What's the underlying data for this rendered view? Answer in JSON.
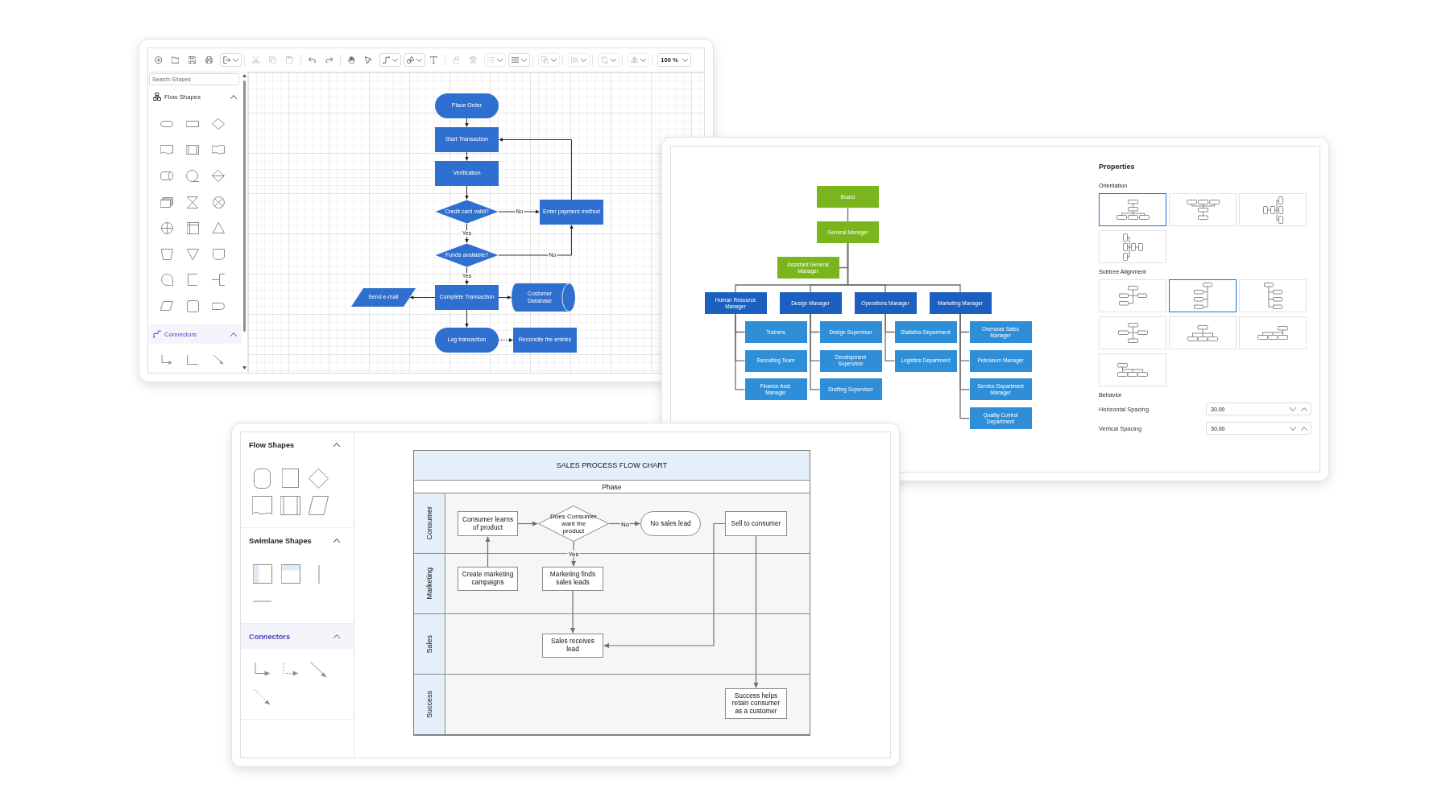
{
  "flowchart_editor": {
    "toolbar": {
      "groups": [
        {
          "items": [
            {
              "kind": "button",
              "disabled": false
            },
            {
              "kind": "button",
              "disabled": false
            },
            {
              "kind": "button",
              "disabled": false
            },
            {
              "kind": "button",
              "disabled": false
            },
            {
              "kind": "dropdown",
              "disabled": false
            }
          ]
        },
        {
          "items": [
            {
              "kind": "button",
              "disabled": true
            },
            {
              "kind": "button",
              "disabled": true
            },
            {
              "kind": "button",
              "disabled": true
            }
          ]
        },
        {
          "items": [
            {
              "kind": "button",
              "disabled": false
            },
            {
              "kind": "button",
              "disabled": false
            }
          ]
        },
        {
          "items": [
            {
              "kind": "button",
              "disabled": false
            },
            {
              "kind": "button",
              "disabled": false
            },
            {
              "kind": "dropdown",
              "disabled": false
            },
            {
              "kind": "dropdown",
              "disabled": false
            },
            {
              "kind": "button",
              "disabled": false
            }
          ]
        },
        {
          "items": [
            {
              "kind": "button",
              "disabled": true
            },
            {
              "kind": "button",
              "disabled": true
            },
            {
              "kind": "dropdown",
              "disabled": true
            },
            {
              "kind": "dropdown",
              "disabled": false
            }
          ]
        },
        {
          "items": [
            {
              "kind": "dropdown",
              "disabled": true
            }
          ]
        },
        {
          "items": [
            {
              "kind": "dropdown",
              "disabled": true
            }
          ]
        },
        {
          "items": [
            {
              "kind": "dropdown",
              "disabled": true
            }
          ]
        },
        {
          "items": [
            {
              "kind": "dropdown",
              "disabled": true
            }
          ]
        }
      ],
      "zoom": "100 %"
    },
    "sidebar": {
      "search": {
        "placeholder": "Search Shapes"
      },
      "sections": [
        {
          "kind": "flow",
          "title": "Flow Shapes",
          "expanded": true,
          "selected": false
        },
        {
          "kind": "connector",
          "title": "Connectors",
          "expanded": true,
          "selected": true
        }
      ]
    },
    "diagram": {
      "nodes": [
        {
          "kind": "terminator",
          "label": "Place Order"
        },
        {
          "kind": "process",
          "label": "Start Transaction"
        },
        {
          "kind": "process",
          "label": "Verification"
        },
        {
          "kind": "decision",
          "label": "Credit card valid?"
        },
        {
          "kind": "process",
          "label": "Enter payment method"
        },
        {
          "kind": "decision",
          "label": "Funds available?"
        },
        {
          "kind": "data",
          "label": "Send e-mail"
        },
        {
          "kind": "process",
          "label": "Complete Transaction"
        },
        {
          "kind": "database",
          "label": "Customer Database"
        },
        {
          "kind": "terminator",
          "label": "Log transaction"
        },
        {
          "kind": "process",
          "label": "Reconcile the entries"
        }
      ],
      "connector_labels": [
        "No",
        "Yes",
        "No",
        "Yes"
      ]
    }
  },
  "org_chart_editor": {
    "org_chart": {
      "root": {
        "label": "Board",
        "color": "#7ab51d",
        "children": [
          {
            "label": "General Manager",
            "color": "#7ab51d",
            "children": [
              {
                "label": "Assistant General Manager",
                "color": "#7ab51d"
              },
              {
                "label": "Human Resource Manager",
                "color": "#1b5fbf",
                "children": [
                  {
                    "label": "Trainers",
                    "color": "#2e8ed8"
                  },
                  {
                    "label": "Recruiting Team",
                    "color": "#2e8ed8"
                  },
                  {
                    "label": "Finance Asst. Manager",
                    "color": "#2e8ed8"
                  }
                ]
              },
              {
                "label": "Design Manager",
                "color": "#1b5fbf",
                "children": [
                  {
                    "label": "Design Supervisor",
                    "color": "#2e8ed8"
                  },
                  {
                    "label": "Development Supervisor",
                    "color": "#2e8ed8"
                  },
                  {
                    "label": "Drafting Supervisor",
                    "color": "#2e8ed8"
                  }
                ]
              },
              {
                "label": "Operations Manager",
                "color": "#1b5fbf",
                "children": [
                  {
                    "label": "Statistics Department",
                    "color": "#2e8ed8"
                  },
                  {
                    "label": "Logistics Department",
                    "color": "#2e8ed8"
                  }
                ]
              },
              {
                "label": "Marketing Manager",
                "color": "#1b5fbf",
                "children": [
                  {
                    "label": "Overseas Sales Manager",
                    "color": "#2e8ed8"
                  },
                  {
                    "label": "Petroleum Manager",
                    "color": "#2e8ed8"
                  },
                  {
                    "label": "Service Department Manager",
                    "color": "#2e8ed8"
                  },
                  {
                    "label": "Quality Control Department",
                    "color": "#2e8ed8"
                  }
                ]
              }
            ]
          }
        ]
      }
    },
    "properties": {
      "title": "Properties",
      "orientation": {
        "label": "Orientation",
        "options": [
          {
            "selected": true
          },
          {
            "selected": false
          },
          {
            "selected": false
          },
          {
            "selected": false
          }
        ]
      },
      "subtree_alignment": {
        "label": "Subtree Alignment",
        "options": [
          {
            "selected": false
          },
          {
            "selected": true
          },
          {
            "selected": false
          },
          {
            "selected": false
          },
          {
            "selected": false
          },
          {
            "selected": false
          },
          {
            "selected": false
          }
        ]
      },
      "behavior": {
        "label": "Behavior",
        "fields": [
          {
            "label": "Horizontal Spacing",
            "value": "30.00"
          },
          {
            "label": "Vertical Spacing",
            "value": "30.00"
          }
        ]
      }
    }
  },
  "swimlane_editor": {
    "sidebar": {
      "sections": [
        {
          "kind": "flow",
          "title": "Flow Shapes",
          "expanded": true,
          "selected": false
        },
        {
          "kind": "swimlane",
          "title": "Swimlane Shapes",
          "expanded": true,
          "selected": false
        },
        {
          "kind": "connector",
          "title": "Connectors",
          "expanded": true,
          "selected": true
        }
      ]
    },
    "chart": {
      "title": "SALES PROCESS FLOW CHART",
      "phase": "Phase",
      "lanes": [
        {
          "label": "Consumer",
          "nodes": [
            {
              "kind": "process",
              "label": "Consumer learns of product"
            },
            {
              "kind": "decision",
              "label": "Does Consumer want the product"
            },
            {
              "kind": "terminator",
              "label": "No sales lead"
            },
            {
              "kind": "process",
              "label": "Sell to consumer"
            }
          ]
        },
        {
          "label": "Marketing",
          "nodes": [
            {
              "kind": "process",
              "label": "Create marketing campaigns"
            },
            {
              "kind": "process",
              "label": "Marketing finds sales leads"
            }
          ]
        },
        {
          "label": "Sales",
          "nodes": [
            {
              "kind": "process",
              "label": "Sales receives lead"
            }
          ]
        },
        {
          "label": "Success",
          "nodes": [
            {
              "kind": "process",
              "label": "Success helps retain consumer as a customer"
            }
          ]
        }
      ],
      "connector_labels": [
        "No",
        "Yes"
      ]
    }
  }
}
